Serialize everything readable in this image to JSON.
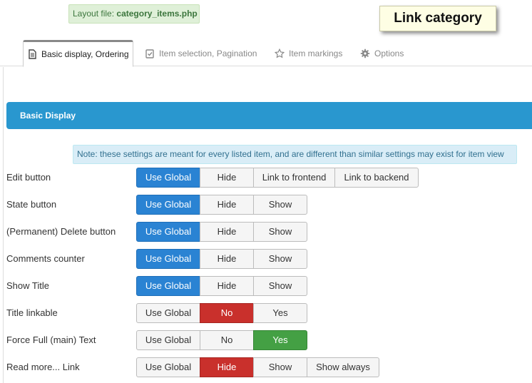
{
  "layout_file": {
    "prefix": "Layout file:",
    "filename": "category_items.php"
  },
  "page_title": "Link category",
  "tabs": [
    {
      "label": "Basic display, Ordering",
      "icon": "document-icon",
      "active": true
    },
    {
      "label": "Item selection, Pagination",
      "icon": "checklist-icon",
      "active": false
    },
    {
      "label": "Item markings",
      "icon": "star-icon",
      "active": false
    },
    {
      "label": "Options",
      "icon": "gear-icon",
      "active": false
    }
  ],
  "section": {
    "title": "Basic Display"
  },
  "note": "Note: these settings are meant for every listed item, and are different than similar settings may exist for item view",
  "colors": {
    "blue": "#2a83d3",
    "red": "#c9302c",
    "green": "#44a044",
    "section": "#2997cf"
  },
  "rows": [
    {
      "label": "Edit button",
      "options": [
        "Use Global",
        "Hide",
        "Link to frontend",
        "Link to backend"
      ],
      "selected": "Use Global",
      "selected_color": "blue"
    },
    {
      "label": "State button",
      "options": [
        "Use Global",
        "Hide",
        "Show"
      ],
      "selected": "Use Global",
      "selected_color": "blue"
    },
    {
      "label": "(Permanent) Delete button",
      "options": [
        "Use Global",
        "Hide",
        "Show"
      ],
      "selected": "Use Global",
      "selected_color": "blue"
    },
    {
      "label": "Comments counter",
      "options": [
        "Use Global",
        "Hide",
        "Show"
      ],
      "selected": "Use Global",
      "selected_color": "blue"
    },
    {
      "label": "Show Title",
      "options": [
        "Use Global",
        "Hide",
        "Show"
      ],
      "selected": "Use Global",
      "selected_color": "blue"
    },
    {
      "label": "Title linkable",
      "options": [
        "Use Global",
        "No",
        "Yes"
      ],
      "selected": "No",
      "selected_color": "red"
    },
    {
      "label": "Force Full (main) Text",
      "options": [
        "Use Global",
        "No",
        "Yes"
      ],
      "selected": "Yes",
      "selected_color": "green"
    },
    {
      "label": "Read more... Link",
      "options": [
        "Use Global",
        "Hide",
        "Show",
        "Show always"
      ],
      "selected": "Hide",
      "selected_color": "red"
    }
  ]
}
